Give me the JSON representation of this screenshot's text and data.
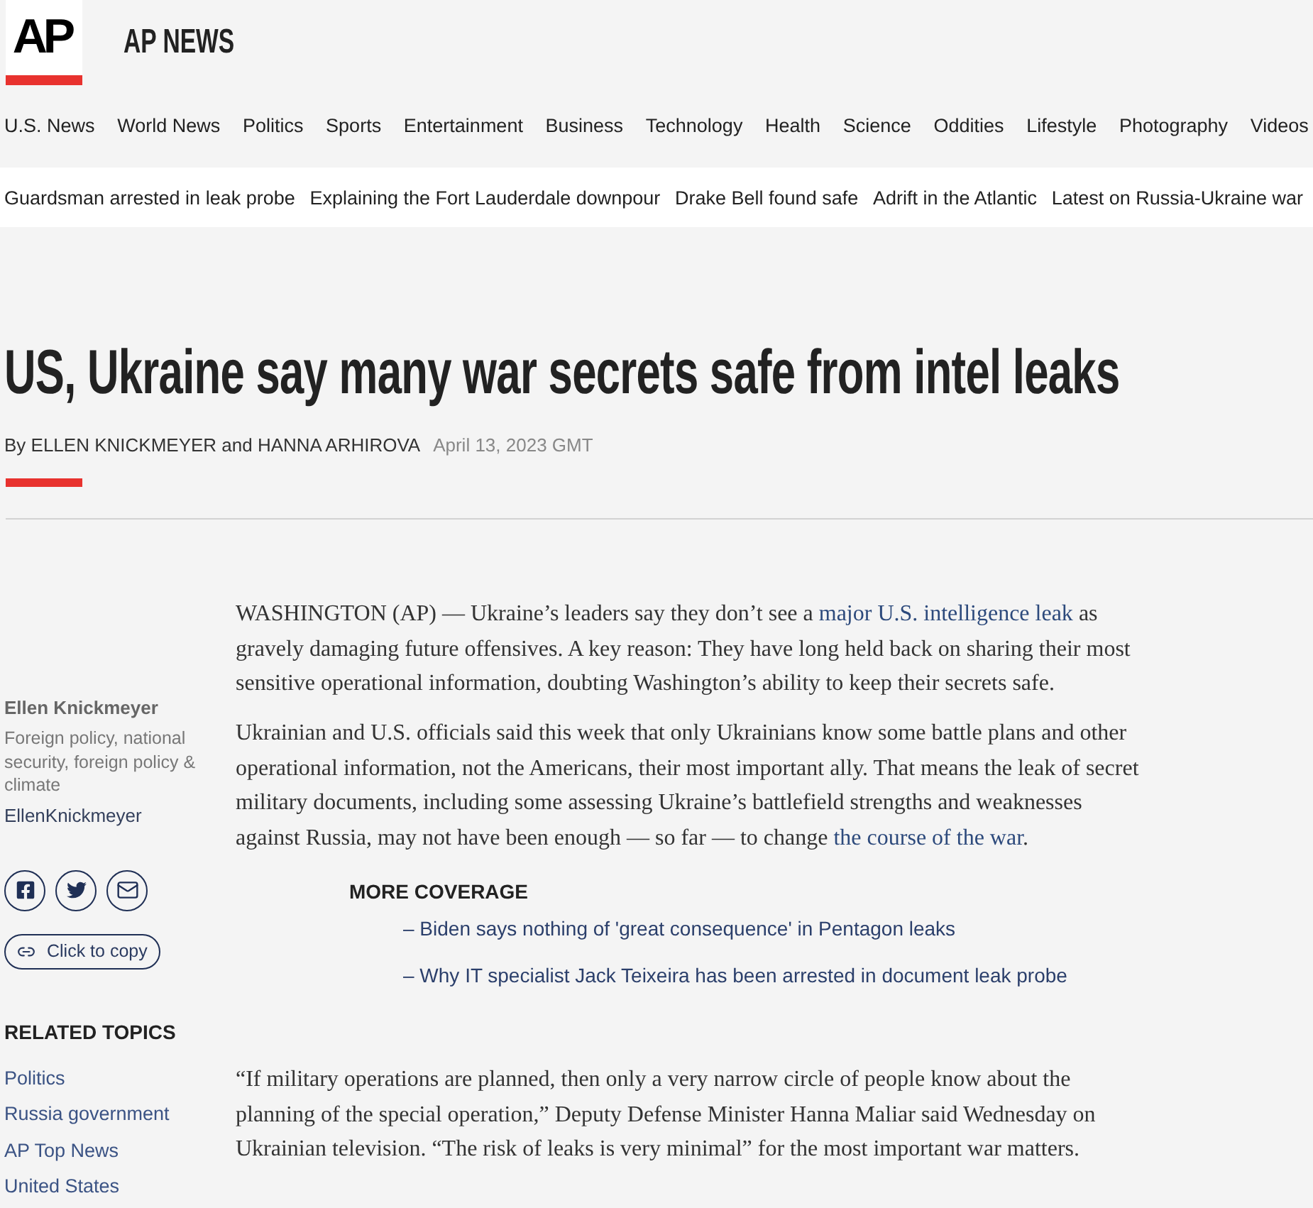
{
  "header": {
    "logo": "AP",
    "site_name": "AP NEWS"
  },
  "nav": [
    "U.S. News",
    "World News",
    "Politics",
    "Sports",
    "Entertainment",
    "Business",
    "Technology",
    "Health",
    "Science",
    "Oddities",
    "Lifestyle",
    "Photography",
    "Videos"
  ],
  "trending": [
    "Guardsman arrested in leak probe",
    "Explaining the Fort Lauderdale downpour",
    "Drake Bell found safe",
    "Adrift in the Atlantic",
    "Latest on Russia-Ukraine war"
  ],
  "article": {
    "headline": "US, Ukraine say many war secrets safe from intel leaks",
    "byline": "By ELLEN KNICKMEYER and HANNA ARHIROVA",
    "date": "April 13, 2023 GMT"
  },
  "author_card": {
    "name": "Ellen Knickmeyer",
    "beat": "Foreign policy, national security, foreign policy & climate",
    "handle": "EllenKnickmeyer",
    "copy_button": "Click to copy"
  },
  "related_topics": {
    "title": "RELATED TOPICS",
    "items": [
      "Politics",
      "Russia government",
      "AP Top News",
      "United States"
    ]
  },
  "body": [
    {
      "kind": "paragraph",
      "segments": [
        {
          "kind": "text",
          "text": "WASHINGTON (AP) — Ukraine’s leaders say they don’t see a "
        },
        {
          "kind": "link",
          "text": "major U.S. intelligence leak"
        },
        {
          "kind": "text",
          "text": " as gravely damaging future offensives. A key reason: They have long held back on sharing their most sensitive operational information, doubting Washington’s ability to keep their secrets safe."
        }
      ]
    },
    {
      "kind": "paragraph",
      "segments": [
        {
          "kind": "text",
          "text": "Ukrainian and U.S. officials said this week that only Ukrainians know some battle plans and other operational information, not the Americans, their most important ally. That means the leak of secret military documents, including some assessing Ukraine’s battlefield strengths and weaknesses against Russia, may not have been enough — so far — to change "
        },
        {
          "kind": "link",
          "text": "the course of the war"
        },
        {
          "kind": "text",
          "text": "."
        }
      ]
    },
    {
      "kind": "more_coverage",
      "title": "MORE COVERAGE",
      "links": [
        "– Biden says nothing of 'great consequence' in Pentagon leaks",
        "– Why IT specialist Jack Teixeira has been arrested in document leak probe"
      ]
    },
    {
      "kind": "paragraph",
      "segments": [
        {
          "kind": "text",
          "text": "“If military operations are planned, then only a very narrow circle of people know about the planning of the special operation,” Deputy Defense Minister Hanna Maliar said Wednesday on Ukrainian television. “The risk of leaks is very minimal” for the most important war matters."
        }
      ]
    }
  ]
}
